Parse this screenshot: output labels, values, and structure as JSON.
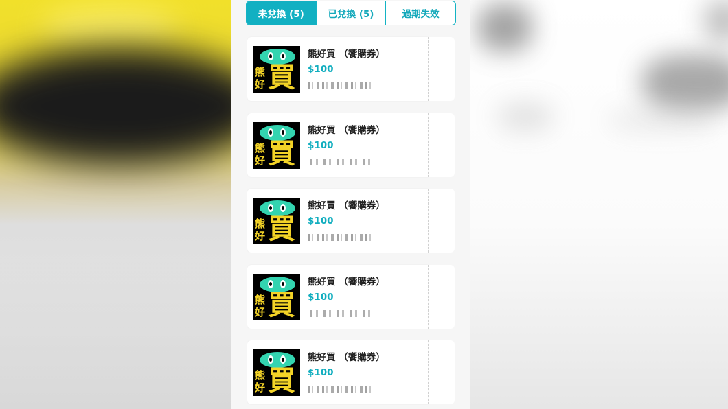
{
  "tabs": [
    {
      "label": "未兌換 (5)",
      "active": true
    },
    {
      "label": "已兌換 (5)",
      "active": false
    },
    {
      "label": "過期失效",
      "active": false
    }
  ],
  "coupons": [
    {
      "title": "熊好買 （饗購券）",
      "price": "$100",
      "logo": {
        "line1": "熊",
        "line2": "好",
        "big": "買"
      }
    },
    {
      "title": "熊好買 （饗購券）",
      "price": "$100",
      "logo": {
        "line1": "熊",
        "line2": "好",
        "big": "買"
      }
    },
    {
      "title": "熊好買 （饗購券）",
      "price": "$100",
      "logo": {
        "line1": "熊",
        "line2": "好",
        "big": "買"
      }
    },
    {
      "title": "熊好買 （饗購券）",
      "price": "$100",
      "logo": {
        "line1": "熊",
        "line2": "好",
        "big": "買"
      }
    },
    {
      "title": "熊好買 （饗購券）",
      "price": "$100",
      "logo": {
        "line1": "熊",
        "line2": "好",
        "big": "買"
      }
    }
  ],
  "colors": {
    "accent": "#12b0c2",
    "logo_yellow": "#f3d327",
    "logo_green": "#33d4b0"
  }
}
